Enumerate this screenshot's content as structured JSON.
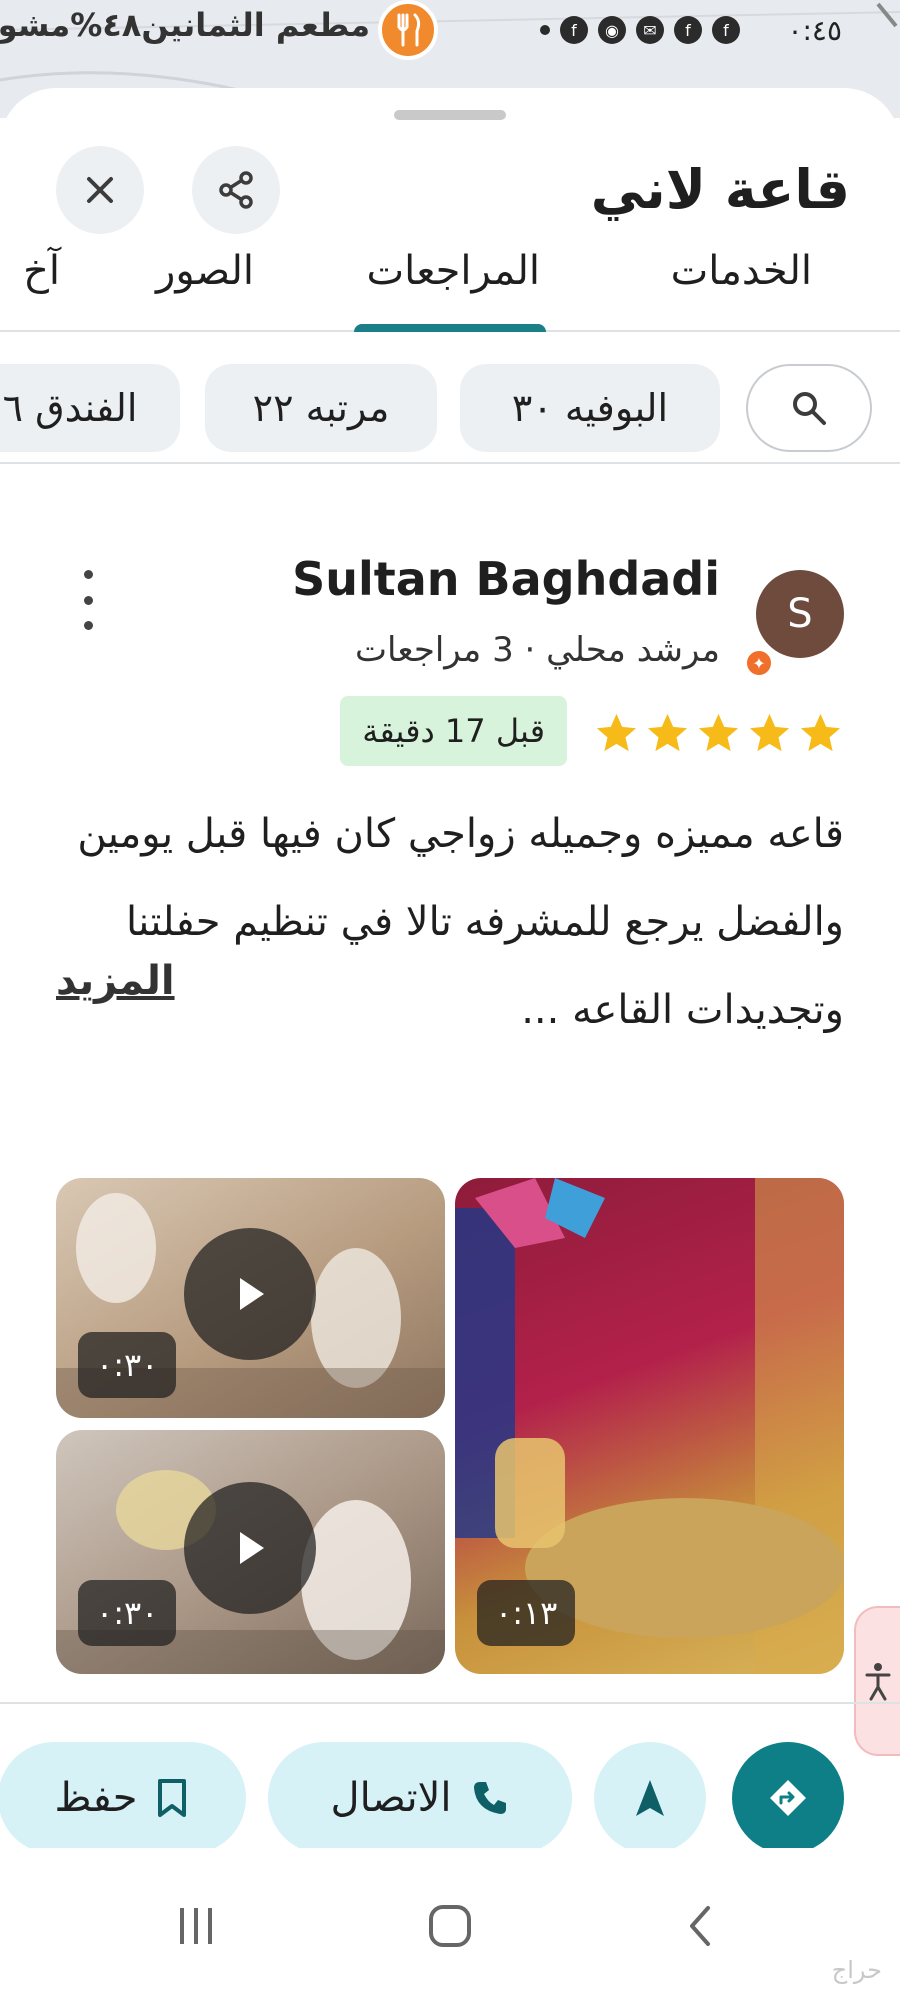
{
  "status_bar": {
    "time": "٠:٤٥",
    "map_label": "مطعم الثمانين٤٨%مشو"
  },
  "header": {
    "title": "قاعة لاني"
  },
  "tabs": [
    {
      "label": "الخدمات"
    },
    {
      "label": "المراجعات",
      "selected": true
    },
    {
      "label": "الصور"
    },
    {
      "label": "آخ"
    }
  ],
  "chips": [
    {
      "label": "البوفيه ٣٠"
    },
    {
      "label": "مرتبه ٢٢"
    },
    {
      "label": "الفندق ٦"
    }
  ],
  "review": {
    "avatar_letter": "S",
    "reviewer_name": "Sultan Baghdadi",
    "reviewer_subtitle": "مرشد محلي · 3 مراجعات",
    "rating": 5,
    "time_ago": "قبل 17 دقيقة",
    "text": "قاعه مميزه وجميله زواجي كان فيها قبل يومين والفضل يرجع للمشرفه تالا في تنظيم حفلتنا وتجديدات القاعه ...",
    "more_label": "المزيد"
  },
  "media": [
    {
      "type": "photo",
      "duration": "٠:١٣"
    },
    {
      "type": "video",
      "duration": "٠:٣٠"
    },
    {
      "type": "video",
      "duration": "٠:٣٠"
    }
  ],
  "actions": {
    "call_label": "الاتصال",
    "save_label": "حفظ"
  },
  "colors": {
    "accent": "#1a7f86",
    "star": "#f6bb19",
    "time_badge_bg": "#d7f3dc",
    "action_bg": "#d6f2f7"
  },
  "watermark": "حراج"
}
